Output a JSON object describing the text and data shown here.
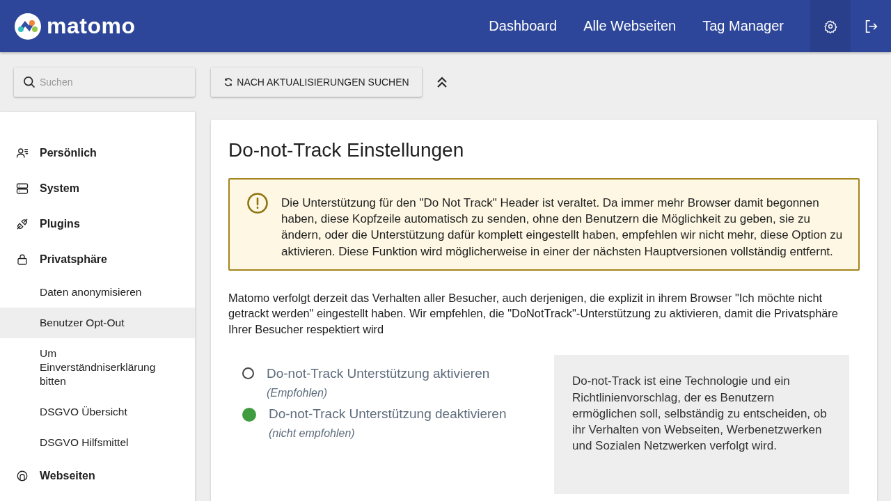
{
  "header": {
    "logo": "matomo",
    "nav": [
      {
        "label": "Dashboard"
      },
      {
        "label": "Alle Webseiten"
      },
      {
        "label": "Tag Manager"
      }
    ],
    "settings_selected": true
  },
  "toolbar": {
    "search": {
      "placeholder": "Suchen"
    },
    "update_button": "NACH AKTUALISIERUNGEN SUCHEN"
  },
  "sidebar": {
    "items": [
      {
        "kind": "section",
        "label": "Persönlich"
      },
      {
        "kind": "section",
        "label": "System"
      },
      {
        "kind": "section",
        "label": "Plugins"
      },
      {
        "kind": "section",
        "label": "Privatsphäre",
        "children": [
          {
            "label": "Daten anonymisieren",
            "selected": false
          },
          {
            "label": "Benutzer Opt-Out",
            "selected": true
          },
          {
            "label": "Um Einverständniserklärung bitten",
            "selected": false
          },
          {
            "label": "DSGVO Übersicht",
            "selected": false
          },
          {
            "label": "DSGVO Hilfsmittel",
            "selected": false
          }
        ]
      },
      {
        "kind": "section",
        "label": "Webseiten"
      }
    ]
  },
  "card": {
    "title": "Do-not-Track Einstellungen",
    "warning": "Die Unterstützung für den \"Do Not Track\" Header ist veraltet. Da immer mehr Browser damit begonnen haben, diese Kopfzeile automatisch zu senden, ohne den Benutzern die Möglichkeit zu geben, sie zu ändern, oder die Unterstützung dafür komplett eingestellt haben, empfehlen wir nicht mehr, diese Option zu aktivieren. Diese Funktion wird möglicherweise in einer der nächsten Hauptversionen vollständig entfernt.",
    "description": "Matomo verfolgt derzeit das Verhalten aller Besucher, auch derjenigen, die explizit in ihrem Browser \"Ich möchte nicht getrackt werden\" eingestellt haben. Wir empfehlen, die \"DoNotTrack\"-Unterstützung zu aktivieren, damit die Privatsphäre Ihrer Besucher respektiert wird",
    "options": [
      {
        "label": "Do-not-Track Unterstützung aktivieren",
        "note": "(Empfohlen)",
        "selected": false
      },
      {
        "label": "Do-not-Track Unterstützung deaktivieren",
        "note": "(nicht empfohlen)",
        "selected": true
      }
    ],
    "help": "Do-not-Track ist eine Technologie und ein Richtlinienvorschlag, der es Benutzern ermöglichen soll, selbständig zu entscheiden, ob ihr Verhalten von Webseiten, Werbenetzwerken und Sozialen Netzwerken verfolgt wird."
  }
}
